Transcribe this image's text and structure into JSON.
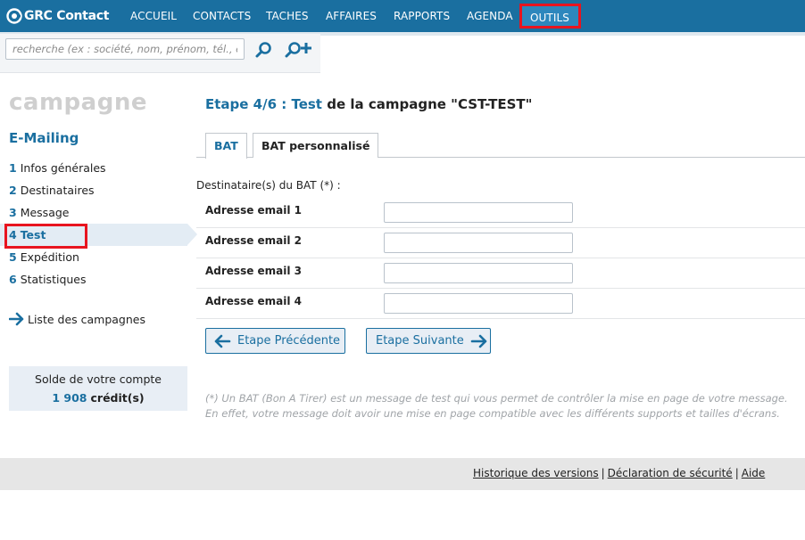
{
  "brand": {
    "name": "GRC Contact"
  },
  "nav": {
    "items": [
      {
        "label": "ACCUEIL"
      },
      {
        "label": "CONTACTS"
      },
      {
        "label": "TACHES"
      },
      {
        "label": "AFFAIRES"
      },
      {
        "label": "RAPPORTS"
      },
      {
        "label": "AGENDA"
      },
      {
        "label": "OUTILS",
        "highlighted": true
      }
    ]
  },
  "search": {
    "placeholder": "recherche (ex : société, nom, prénom, tél., e",
    "search_icon": "search-icon",
    "add_icon": "add-contact-icon"
  },
  "sidebar": {
    "title": "campagne",
    "subtitle": "E-Mailing",
    "steps": [
      {
        "num": "1",
        "label": "Infos générales",
        "active": false
      },
      {
        "num": "2",
        "label": "Destinataires",
        "active": false
      },
      {
        "num": "3",
        "label": "Message",
        "active": false
      },
      {
        "num": "4",
        "label": "Test",
        "active": true
      },
      {
        "num": "5",
        "label": "Expédition",
        "active": false
      },
      {
        "num": "6",
        "label": "Statistiques",
        "active": false
      }
    ],
    "list_link": "Liste des campagnes",
    "balance": {
      "label": "Solde de votre compte",
      "count": "1 908",
      "unit": "crédit(s)"
    }
  },
  "main": {
    "title_prefix": "Etape 4/6 : Test",
    "title_suffix": " de la campagne \"CST-TEST\"",
    "tabs": [
      {
        "label": "BAT",
        "active": true
      },
      {
        "label": "BAT personnalisé",
        "active": false
      }
    ],
    "dest_label": "Destinataire(s) du BAT (*) :",
    "fields": [
      {
        "label": "Adresse email 1",
        "value": ""
      },
      {
        "label": "Adresse email 2",
        "value": ""
      },
      {
        "label": "Adresse email 3",
        "value": ""
      },
      {
        "label": "Adresse email 4",
        "value": ""
      }
    ],
    "prev_button": "Etape Précédente",
    "next_button": "Etape Suivante",
    "note_line1": "(*) Un BAT (Bon A Tirer) est un message de test qui vous permet de contrôler la mise en page de votre message.",
    "note_line2": "En effet, votre message doit avoir une mise en page compatible avec les différents supports et tailles d'écrans."
  },
  "footer": {
    "links": [
      "Historique des versions",
      "Déclaration de sécurité",
      "Aide"
    ],
    "separator": "|"
  },
  "colors": {
    "primary": "#1a6fa0",
    "highlight": "#e8141f",
    "panel": "#e8eef5"
  }
}
